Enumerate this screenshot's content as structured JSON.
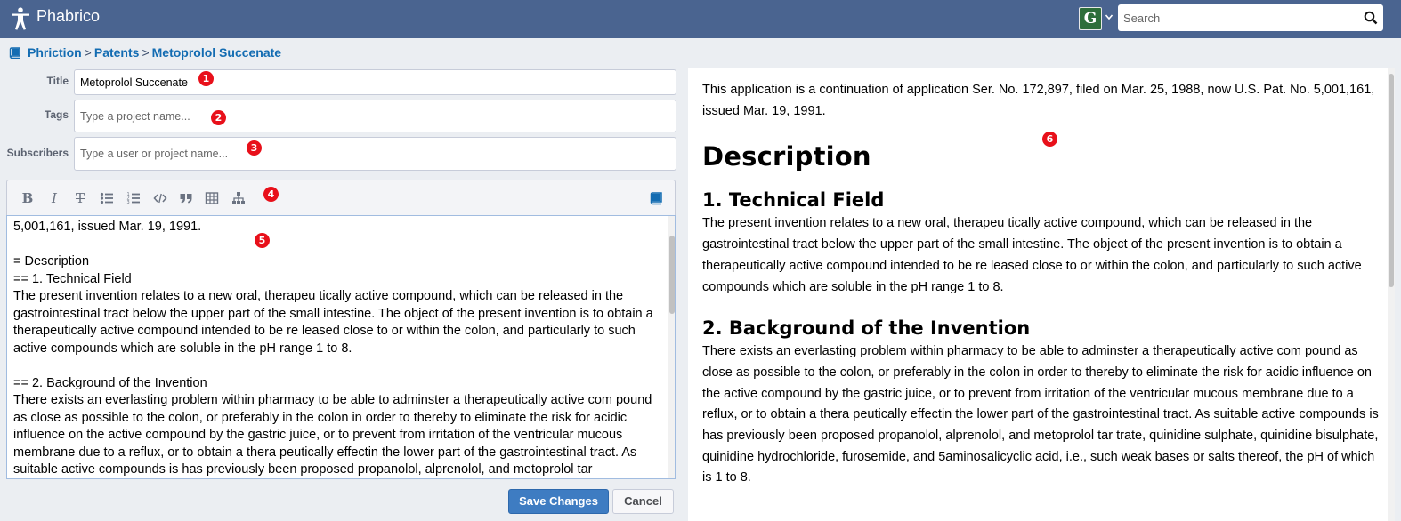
{
  "app": {
    "name": "Phabrico",
    "avatar_letter": "G"
  },
  "search": {
    "placeholder": "Search"
  },
  "breadcrumb": [
    "Phriction",
    "Patents",
    "Metoprolol Succenate"
  ],
  "form": {
    "title_label": "Title",
    "title_value": "Metoprolol Succenate",
    "tags_label": "Tags",
    "tags_placeholder": "Type a project name...",
    "subscribers_label": "Subscribers",
    "subscribers_placeholder": "Type a user or project name..."
  },
  "toolbar": {
    "icons": [
      "bold-icon",
      "italic-icon",
      "strikethrough-icon",
      "bullet-list-icon",
      "numbered-list-icon",
      "code-icon",
      "quote-icon",
      "table-icon",
      "tree-icon",
      "book-icon"
    ]
  },
  "editor": {
    "content": "5,001,161, issued Mar. 19, 1991.\n\n= Description\n== 1. Technical Field\nThe present invention relates to a new oral, therapeu tically active compound, which can be released in the gastrointestinal tract below the upper part of the small intestine. The object of the present invention is to obtain a therapeutically active compound intended to be re leased close to or within the colon, and particularly to such active compounds which are soluble in the pH range 1 to 8.\n\n== 2. Background of the Invention\nThere exists an everlasting problem within pharmacy to be able to adminster a therapeutically active com pound as close as possible to the colon, or preferably in the colon in order to thereby to eliminate the risk for acidic influence on the active compound by the gastric juice, or to prevent from irritation of the ventricular mucous membrane due to a reflux, or to obtain a thera peutically effectin the lower part of the gastrointestinal tract. As suitable active compounds is has previously been proposed propanolol, alprenolol, and metoprolol tar"
  },
  "buttons": {
    "save": "Save Changes",
    "cancel": "Cancel"
  },
  "preview": {
    "intro": "This application is a continuation of application Ser. No. 172,897, filed on Mar. 25, 1988, now U.S. Pat. No. 5,001,161, issued Mar. 19, 1991.",
    "heading": "Description",
    "section1_title": "1. Technical Field",
    "section1_text": "The present invention relates to a new oral, therapeu tically active compound, which can be released in the gastrointestinal tract below the upper part of the small intestine. The object of the present invention is to obtain a therapeutically active compound intended to be re leased close to or within the colon, and particularly to such active compounds which are soluble in the pH range 1 to 8.",
    "section2_title": "2. Background of the Invention",
    "section2_text": "There exists an everlasting problem within pharmacy to be able to adminster a therapeutically active com pound as close as possible to the colon, or preferably in the colon in order to thereby to eliminate the risk for acidic influence on the active compound by the gastric juice, or to prevent from irritation of the ventricular mucous membrane due to a reflux, or to obtain a thera peutically effectin the lower part of the gastrointestinal tract. As suitable active compounds is has previously been proposed propanolol, alprenolol, and metoprolol tar trate, quinidine sulphate, quinidine bisulphate, quinidine hydrochloride, furosemide, and 5aminosalicyclic acid, i.e., such weak bases or salts thereof, the pH of which is 1 to 8."
  },
  "markers": [
    "1",
    "2",
    "3",
    "4",
    "5",
    "6"
  ],
  "colors": {
    "topbar": "#4a6490",
    "link": "#136cb2",
    "primary_button": "#3e7cc2",
    "marker": "#e8101a"
  }
}
